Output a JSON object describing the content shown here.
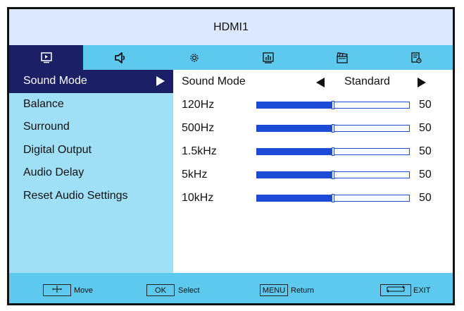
{
  "title": "HDMI1",
  "tabs": [
    {
      "icon": "picture-icon",
      "active": true
    },
    {
      "icon": "speaker-icon",
      "active": false
    },
    {
      "icon": "gear-icon",
      "active": false
    },
    {
      "icon": "chart-icon",
      "active": false
    },
    {
      "icon": "clapperboard-icon",
      "active": false
    },
    {
      "icon": "timer-document-icon",
      "active": false
    }
  ],
  "sidebar": {
    "items": [
      {
        "label": "Sound Mode"
      },
      {
        "label": "Balance"
      },
      {
        "label": "Surround"
      },
      {
        "label": "Digital Output"
      },
      {
        "label": "Audio Delay"
      },
      {
        "label": "Reset Audio Settings"
      }
    ]
  },
  "content": {
    "sound_mode": {
      "label": "Sound Mode",
      "value": "Standard"
    },
    "eq": [
      {
        "label": "120Hz",
        "value": "50",
        "level": 50
      },
      {
        "label": "500Hz",
        "value": "50",
        "level": 50
      },
      {
        "label": "1.5kHz",
        "value": "50",
        "level": 50
      },
      {
        "label": "5kHz",
        "value": "50",
        "level": 50
      },
      {
        "label": "10kHz",
        "value": "50",
        "level": 50
      }
    ]
  },
  "footer": {
    "move": {
      "label": "Move"
    },
    "select": {
      "key": "OK",
      "label": "Select"
    },
    "return": {
      "key": "MENU",
      "label": "Return"
    },
    "exit": {
      "label": "EXIT"
    }
  },
  "colors": {
    "accent_dark": "#1a1f66",
    "tab_bar": "#5ec9ee",
    "sidebar": "#9fe0f6",
    "slider": "#1c4bd6"
  }
}
